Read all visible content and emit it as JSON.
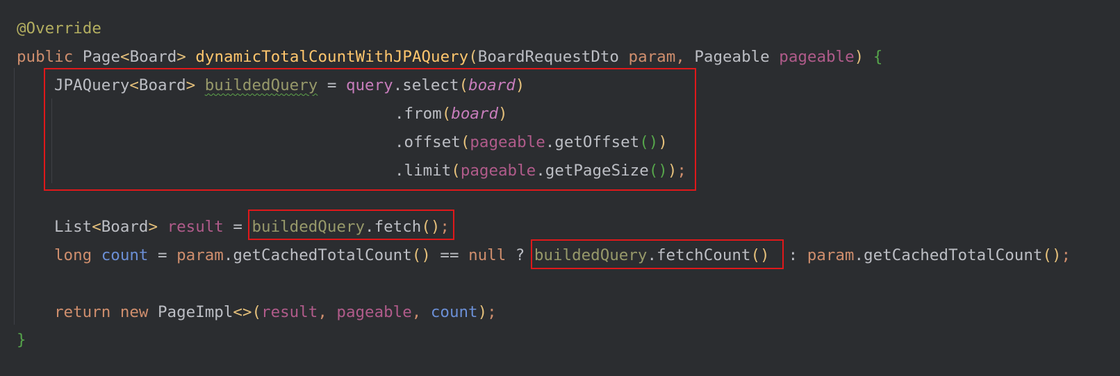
{
  "code": {
    "annotation": "@Override",
    "l2": {
      "kw_public": "public",
      "type_page": "Page",
      "lt": "<",
      "type_board": "Board",
      "gt": ">",
      "method": "dynamicTotalCountWithJPAQuery",
      "paren_open": "(",
      "type_dto": "BoardRequestDto",
      "param1": "param",
      "comma": ", ",
      "type_pageable": "Pageable",
      "param2": "pageable",
      "paren_close": ")",
      "brace": "{"
    },
    "l3": {
      "type": "JPAQuery",
      "lt": "<",
      "generic": "Board",
      "gt": ">",
      "var": "buildedQuery",
      "eq": " = ",
      "field": "query",
      "call": ".select",
      "po": "(",
      "arg": "board",
      "pc": ")"
    },
    "l4": {
      "call": ".from",
      "po": "(",
      "arg": "board",
      "pc": ")"
    },
    "l5": {
      "call": ".offset",
      "po": "(",
      "obj": "pageable",
      "m": ".getOffset",
      "inner": "()",
      "pc": ")"
    },
    "l6": {
      "call": ".limit",
      "po": "(",
      "obj": "pageable",
      "m": ".getPageSize",
      "inner": "()",
      "pc": ")",
      "semi": ";"
    },
    "l8": {
      "type": "List",
      "lt": "<",
      "generic": "Board",
      "gt": ">",
      "var": "result",
      "eq": " = ",
      "obj": "buildedQuery",
      "m": ".fetch",
      "parens": "()",
      "semi": ";"
    },
    "l9": {
      "kw": "long",
      "var": "count",
      "eq": " = ",
      "obj": "param",
      "m": ".getCachedTotalCount",
      "parens": "()",
      "op": " == ",
      "kw_null": "null",
      "q": " ? ",
      "obj2": "buildedQuery",
      "m2": ".fetchCount",
      "parens2": "()",
      "colon": " : ",
      "obj3": "param",
      "m3": ".getCachedTotalCount",
      "parens3": "()",
      "semi": ";"
    },
    "l11": {
      "kw_return": "return",
      "kw_new": "new",
      "type": "PageImpl",
      "diamond": "<>",
      "po": "(",
      "a1": "result",
      "c1": ", ",
      "a2": "pageable",
      "c2": ", ",
      "a3": "count",
      "pc": ")",
      "semi": ";"
    },
    "closing_brace": "}"
  },
  "colors": {
    "background": "#2b2d30",
    "highlight_box": "#e0181a",
    "keyword": "#cf8e6d",
    "method_decl": "#ffc66d",
    "field": "#c77dbb"
  }
}
